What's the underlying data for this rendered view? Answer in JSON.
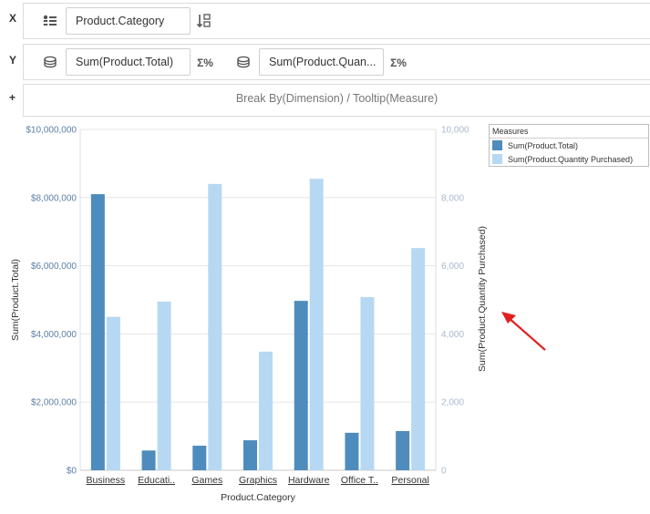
{
  "shelves": {
    "x": {
      "label": "X",
      "field": "Product.Category"
    },
    "y": {
      "label": "Y",
      "fields": [
        "Sum(Product.Total)",
        "Sum(Product.Quan..."
      ],
      "agg_icon": "Σ%"
    },
    "extra": {
      "label": "+",
      "placeholder": "Break By(Dimension) / Tooltip(Measure)"
    }
  },
  "chart_data": {
    "type": "bar",
    "categories": [
      "Business",
      "Educati..",
      "Games",
      "Graphics",
      "Hardware",
      "Office T..",
      "Personal"
    ],
    "series": [
      {
        "name": "Sum(Product.Total)",
        "axis": "left",
        "color": "#4e8cbd",
        "values": [
          8100000,
          580000,
          720000,
          880000,
          4970000,
          1100000,
          1150000
        ]
      },
      {
        "name": "Sum(Product.Quantity Purchased)",
        "axis": "right",
        "color": "#b7d8f2",
        "values": [
          4500,
          4950,
          8400,
          3480,
          8550,
          5080,
          6520
        ]
      }
    ],
    "xlabel": "Product.Category",
    "ylabel_left": "Sum(Product.Total)",
    "ylabel_right": "Sum(Product.Quantity Purchased)",
    "ylim_left": [
      0,
      10000000
    ],
    "ylim_right": [
      0,
      10000
    ],
    "yticks_left": [
      "$0",
      "$2,000,000",
      "$4,000,000",
      "$6,000,000",
      "$8,000,000",
      "$10,000,000"
    ],
    "yticks_right": [
      "0",
      "2,000",
      "4,000",
      "6,000",
      "8,000",
      "10,000"
    ],
    "grid": true,
    "legend": {
      "title": "Measures",
      "position": "top-right"
    }
  },
  "colors": {
    "annotation_arrow": "#e02020"
  }
}
